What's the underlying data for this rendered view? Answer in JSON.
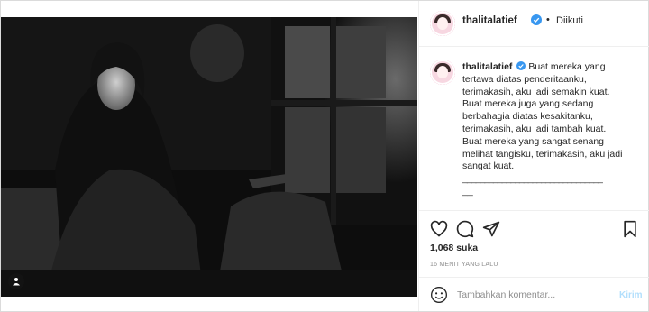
{
  "post": {
    "username": "thalitalatief",
    "separator": "•",
    "follow_label": "Diikuti",
    "caption": {
      "username": "thalitalatief",
      "lines": [
        "Buat mereka yang",
        "tertawa diatas penderitaanku,",
        "terimakasih, aku jadi semakin kuat.",
        "Buat mereka juga yang sedang",
        "berbahagia diatas kesakitanku,",
        "terimakasih, aku jadi tambah kuat.",
        "Buat mereka yang sangat senang",
        "melihat tangisku, terimakasih, aku jadi",
        "sangat kuat.",
        "________________________________",
        "__"
      ]
    },
    "likes": "1,068 suka",
    "timestamp": "16 MENIT YANG LALU",
    "comment_placeholder": "Tambahkan komentar...",
    "post_button": "Kirim"
  },
  "icons": {
    "verified": "verified-badge-icon",
    "like": "heart-icon",
    "comment": "comment-icon",
    "share": "share-icon",
    "save": "bookmark-icon",
    "emoji": "emoji-icon",
    "tag": "person-tag-icon"
  },
  "colors": {
    "verified_blue": "#3897f0",
    "post_button_disabled": "#b2dffc",
    "text_primary": "#262626",
    "text_secondary": "#8e8e8e"
  }
}
